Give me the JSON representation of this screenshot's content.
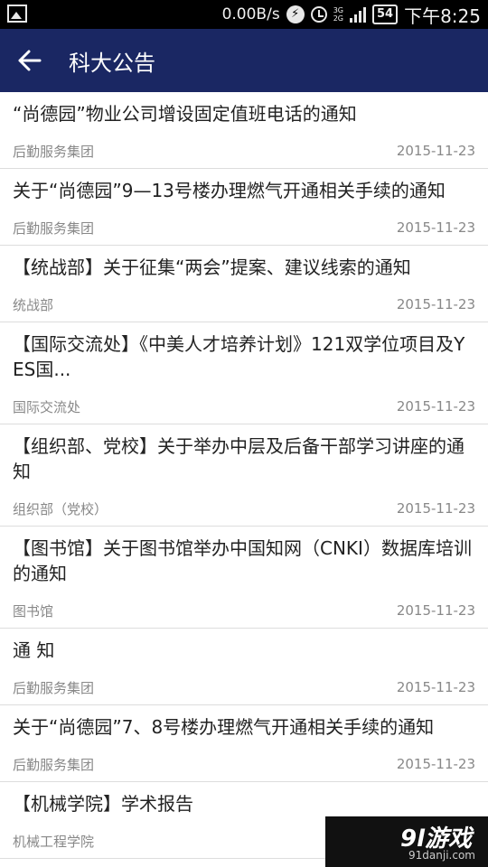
{
  "status_bar": {
    "speed": "0.00B/s",
    "net_top": "3G",
    "net_bottom": "2G",
    "battery": "54",
    "time": "下午8:25"
  },
  "header": {
    "title": "科大公告"
  },
  "announcements": [
    {
      "title": "“尚德园”物业公司增设固定值班电话的通知",
      "source": "后勤服务集团",
      "date": "2015-11-23"
    },
    {
      "title": " 关于“尚德园”9—13号楼办理燃气开通相关手续的通知",
      "source": "后勤服务集团",
      "date": "2015-11-23"
    },
    {
      "title": "【统战部】关于征集“两会”提案、建议线索的通知",
      "source": "统战部",
      "date": "2015-11-23"
    },
    {
      "title": "【国际交流处】《中美人才培养计划》121双学位项目及YES国...",
      "source": "国际交流处",
      "date": "2015-11-23"
    },
    {
      "title": "【组织部、党校】关于举办中层及后备干部学习讲座的通知",
      "source": "组织部（党校）",
      "date": "2015-11-23"
    },
    {
      "title": "【图书馆】关于图书馆举办中国知网（CNKI）数据库培训的通知",
      "source": "图书馆",
      "date": "2015-11-23"
    },
    {
      "title": "通 知",
      "source": "后勤服务集团",
      "date": "2015-11-23"
    },
    {
      "title": "关于“尚德园”7、8号楼办理燃气开通相关手续的通知",
      "source": "后勤服务集团",
      "date": "2015-11-23"
    },
    {
      "title": "【机械学院】学术报告",
      "source": "机械工程学院",
      "date": ""
    }
  ],
  "watermark": {
    "logo": "9l游戏",
    "url": "91danji.com"
  },
  "colors": {
    "app_bar": "#1a2763",
    "status_bar": "#000000"
  }
}
